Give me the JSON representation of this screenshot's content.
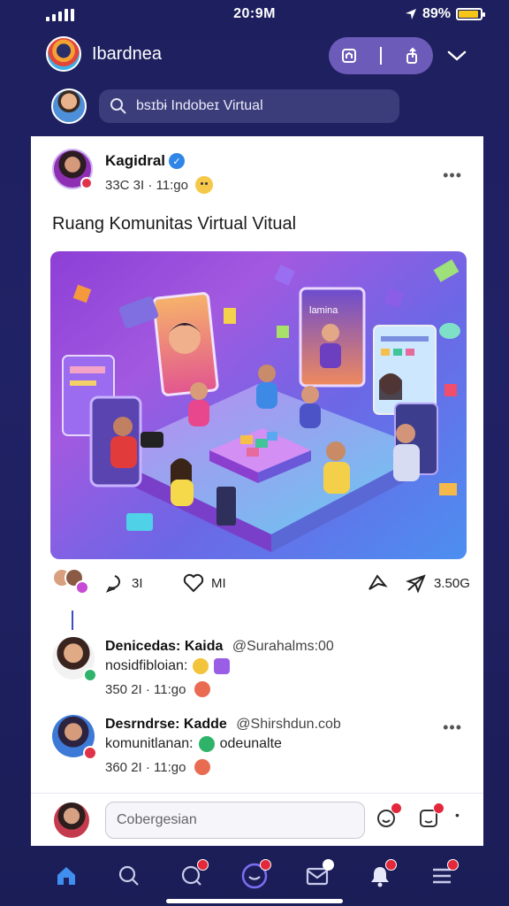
{
  "status_bar": {
    "time": "20:9M",
    "battery_text": "89%"
  },
  "header": {
    "title": "Ibardnea"
  },
  "search": {
    "placeholder": "bsɪbɨ Indobeɪ Virtual"
  },
  "post": {
    "author": "Kagidral",
    "timestamp": "33C 3I · 11:go",
    "text": "Ruang Komunitas Virtual Vitual",
    "actions": {
      "comments": "3I",
      "likes": "MI",
      "shares": "3.50G"
    }
  },
  "comments": [
    {
      "name": "Denicedas: Kaida",
      "handle": "@Surahalms:00",
      "body": "nosidfibloian:",
      "timestamp": "350 2I · 11:go"
    },
    {
      "name": "Desrndrse: Kadde",
      "handle": "@Shirshdun.cob",
      "body": "komunitlanan:",
      "extra": "odeunalte",
      "timestamp": "360 2I · 11:go"
    }
  ],
  "reply": {
    "placeholder": "Cobergesian"
  },
  "colors": {
    "accent": "#6c5bb8",
    "background": "#1d1f5e",
    "verified": "#2f86e6",
    "badge": "#e3283c"
  },
  "icons": [
    "menu-icon",
    "home-icon",
    "search-icon",
    "chat-icon",
    "clock-icon",
    "mail-icon",
    "notification-icon",
    "menu-list-icon"
  ]
}
